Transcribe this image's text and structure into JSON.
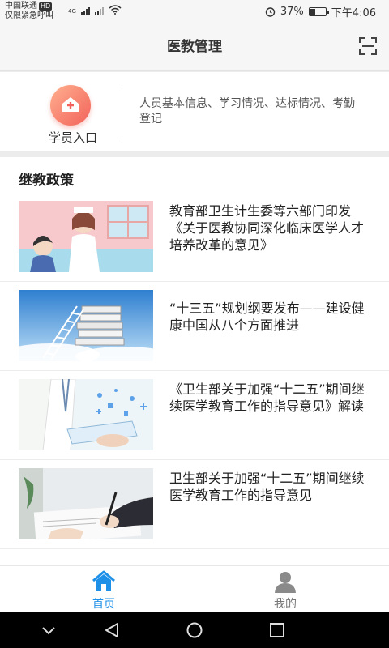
{
  "status_bar": {
    "carrier": "中国联通",
    "hd_badge": "HD",
    "emergency": "仅限紧急呼叫",
    "network": "4G",
    "battery": "37%",
    "battery_level": 0.37,
    "time": "下午4:06"
  },
  "header": {
    "title": "医教管理",
    "scan_icon": "scan-icon"
  },
  "entry": {
    "label": "学员入口",
    "icon": "medical-kit-icon",
    "description": "人员基本信息、学习情况、达标情况、考勤登记"
  },
  "policy": {
    "section_title": "继教政策",
    "items": [
      {
        "title": "教育部卫生计生委等六部门印发《关于医教协同深化临床医学人才培养改革的意见》",
        "image": "nurse-illustration"
      },
      {
        "title": "“十三五”规划纲要发布——建设健康中国从八个方面推进",
        "image": "books-ladder-sky"
      },
      {
        "title": "《卫生部关于加强“十二五”期间继续医学教育工作的指导意见》解读",
        "image": "doctor-tablet"
      },
      {
        "title": "卫生部关于加强“十二五”期间继续医学教育工作的指导意见",
        "image": "signing-document"
      }
    ]
  },
  "tabbar": {
    "home": "首页",
    "mine": "我的",
    "active_color": "#1e90e8",
    "inactive_color": "#777777"
  },
  "navbar": {
    "icons": [
      "chevron-down-icon",
      "back-icon",
      "home-circle-icon",
      "recents-square-icon"
    ]
  }
}
